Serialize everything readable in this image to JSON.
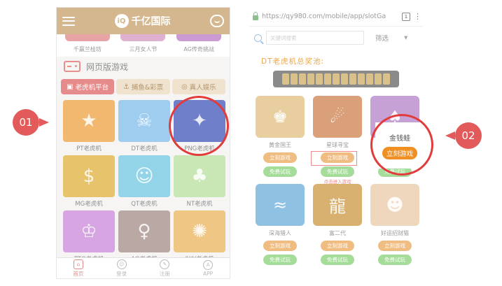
{
  "left_phone": {
    "header": {
      "brand": "千亿国际",
      "logo_mark": "iQ"
    },
    "top_row": [
      {
        "label": "千赢兰桂坊",
        "color": "#e8a4a4"
      },
      {
        "label": "三月女人节",
        "color": "#dfb0cf"
      },
      {
        "label": "AG传奇挑战",
        "color": "#c99bd2"
      }
    ],
    "section_title": "网页版游戏",
    "tabs": [
      {
        "label": "老虎机平台",
        "icon": "slot-icon",
        "active": true
      },
      {
        "label": "捕鱼&彩票",
        "icon": "fish-icon",
        "active": false
      },
      {
        "label": "真人娱乐",
        "icon": "chip-icon",
        "active": false
      }
    ],
    "games": [
      {
        "label": "PT老虎机",
        "color": "#f2b86f",
        "glyph": "★"
      },
      {
        "label": "DT老虎机",
        "color": "#9ecdf0",
        "glyph": "☠"
      },
      {
        "label": "PNG老虎机",
        "color": "#6f7fc9",
        "glyph": "✦"
      },
      {
        "label": "MG老虎机",
        "color": "#e7c46c",
        "glyph": "$"
      },
      {
        "label": "QT老虎机",
        "color": "#93d4e8",
        "glyph": "☺"
      },
      {
        "label": "NT老虎机",
        "color": "#c9e6b5",
        "glyph": "♣"
      },
      {
        "label": "TTG老虎机",
        "color": "#d7a6e2",
        "glyph": "♔"
      },
      {
        "label": "AG老虎机",
        "color": "#b9a8a4",
        "glyph": "♀"
      },
      {
        "label": "SKY老虎机",
        "color": "#f0c685",
        "glyph": "✺"
      }
    ],
    "nav": [
      {
        "label": "首页",
        "icon": "home-icon",
        "glyph": "⌂",
        "active": true
      },
      {
        "label": "登录",
        "icon": "user-icon",
        "glyph": "☺",
        "active": false
      },
      {
        "label": "注册",
        "icon": "edit-icon",
        "glyph": "✎",
        "active": false
      },
      {
        "label": "APP",
        "icon": "app-icon",
        "glyph": "A",
        "active": false
      }
    ]
  },
  "right_phone": {
    "url": "https://qy980.com/mobile/app/slotGa",
    "tabs_count": "1",
    "search": {
      "placeholder": "关键词搜索"
    },
    "filter_label": "筛选",
    "jackpot_title": "DT老虎机总奖池:",
    "jackpot_digits": [
      "",
      "",
      "",
      "",
      "",
      "",
      "",
      "",
      "",
      "",
      "",
      "",
      ""
    ],
    "play_label": "立刻游戏",
    "free_label": "免费试玩",
    "hint": "点击进入游戏",
    "games": [
      {
        "name": "黄金国王",
        "color": "#e9cfa0",
        "glyph": "♚"
      },
      {
        "name": "星球寻宝",
        "color": "#d9a07a",
        "glyph": "☄"
      },
      {
        "name": "金钱蛙",
        "color": "#c5a1d6",
        "glyph": "♠"
      },
      {
        "name": "深海猎人",
        "color": "#8fc1e3",
        "glyph": "≈"
      },
      {
        "name": "富二代",
        "color": "#d8b070",
        "glyph": "龍"
      },
      {
        "name": "好运招财猫",
        "color": "#efd7bd",
        "glyph": "☻"
      }
    ],
    "popup": {
      "name": "金钱蛙",
      "button": "立刻游戏"
    }
  },
  "markers": {
    "first": "01",
    "second": "02"
  }
}
